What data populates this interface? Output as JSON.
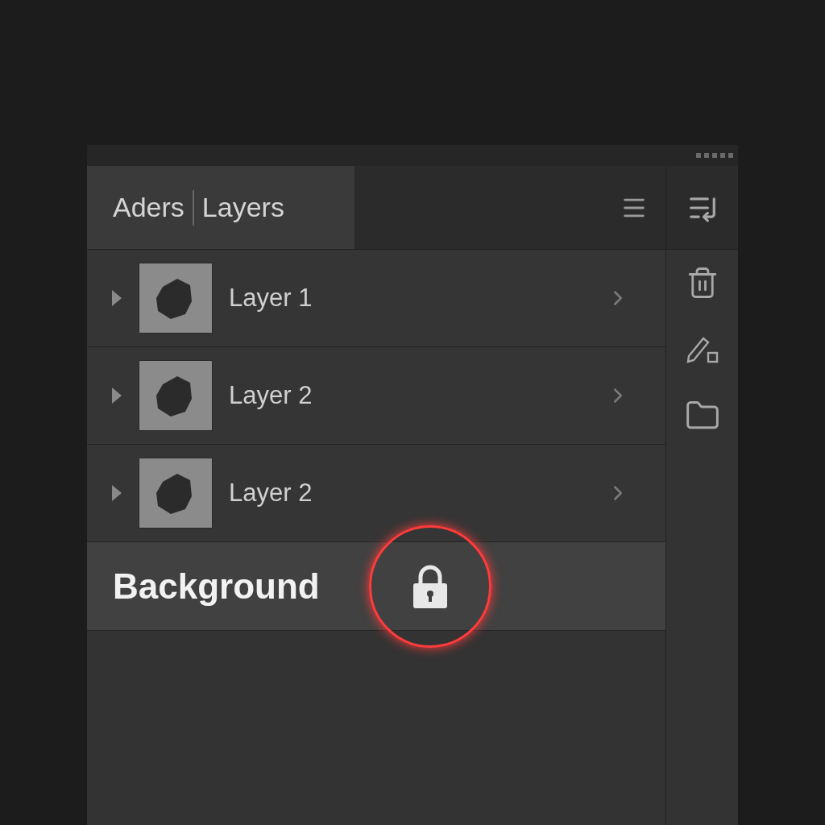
{
  "tabs": [
    {
      "label": "Aders"
    },
    {
      "label": "Layers"
    }
  ],
  "layers": [
    {
      "kind": "layer",
      "name": "Layer 1",
      "selected": false
    },
    {
      "kind": "layer",
      "name": "Layer 2",
      "selected": false
    },
    {
      "kind": "layer",
      "name": "Layer 2",
      "selected": false
    },
    {
      "kind": "background",
      "name": "Background",
      "selected": true,
      "locked": true,
      "highlighted": true
    }
  ]
}
